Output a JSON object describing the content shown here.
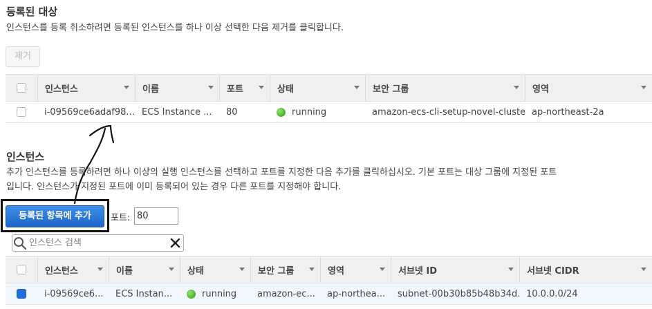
{
  "registered": {
    "title": "등록된 대상",
    "description": "인스턴스를 등록 취소하려면 등록된 인스턴스를 하나 이상 선택한 다음 제거를 클릭합니다.",
    "remove_label": "제거",
    "columns": [
      "인스턴스",
      "이름",
      "포트",
      "상태",
      "보안 그룹",
      "영역"
    ],
    "rows": [
      {
        "instance": "i-09569ce6adaf98...",
        "name": "ECS Instance ...",
        "port": "80",
        "status": "running",
        "security_group": "amazon-ecs-cli-setup-novel-cluste...",
        "zone": "ap-northeast-2a"
      }
    ]
  },
  "instances": {
    "title": "인스턴스",
    "description_line1": "추가 인스턴스를 등록하려면 하나 이상의 실행 인스턴스를 선택하고 포트를 지정한 다음 추가를 클릭하십시오. 기본 포트는 대상 그룹에 지정된 포트",
    "description_line2": "입니다. 인스턴스가 지정된 포트에 이미 등록되어 있는 경우 다른 포트를 지정해야 합니다.",
    "add_label": "등록된 항목에 추가",
    "port_label": "포트:",
    "port_value": "80",
    "search_placeholder": "인스턴스 검색",
    "columns": [
      "인스턴스",
      "이름",
      "상태",
      "보안 그룹",
      "영역",
      "서브넷 ID",
      "서브넷 CIDR"
    ],
    "rows": [
      {
        "instance": "i-09569ce6...",
        "name": "ECS Instan...",
        "status": "running",
        "security_group": "amazon-ec...",
        "zone": "ap-northea...",
        "subnet_id": "subnet-00b30b85b48b34d...",
        "subnet_cidr": "10.0.0.0/24",
        "selected": true
      }
    ]
  },
  "colors": {
    "primary": "#1d66c8",
    "running": "#2f9d16",
    "header_bg": "#f0f0f0"
  }
}
